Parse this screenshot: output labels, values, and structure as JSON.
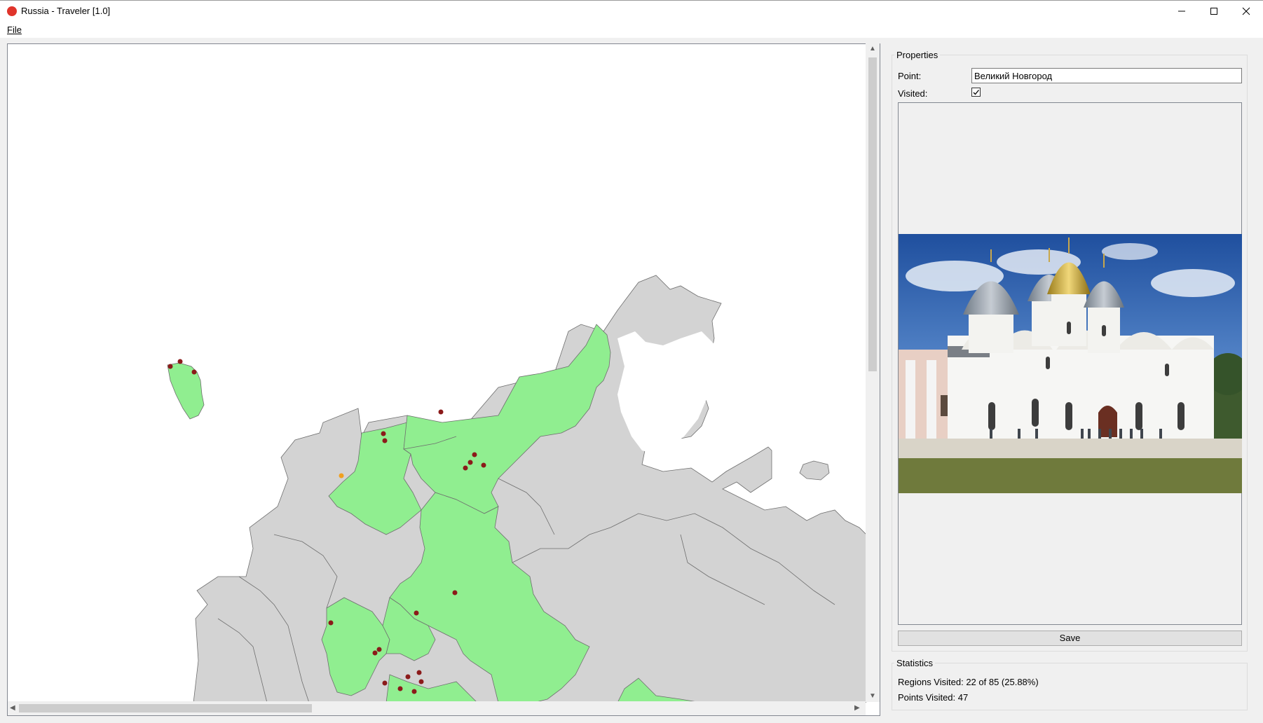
{
  "window": {
    "title": "Russia - Traveler [1.0]",
    "minimize_icon": "minimize-icon",
    "maximize_icon": "maximize-icon",
    "close_icon": "close-icon"
  },
  "menu": {
    "file_label": "File"
  },
  "map": {
    "visited_color": "#90ee90",
    "unvisited_color": "#d3d3d3",
    "point_color": "#8b1a1a",
    "selected_point_color": "#f0a020"
  },
  "properties": {
    "title": "Properties",
    "point_label": "Point:",
    "point_value": "Великий Новгород",
    "visited_label": "Visited:",
    "visited_checked": true
  },
  "save_label": "Save",
  "statistics": {
    "title": "Statistics",
    "regions_text": "Regions Visited: 22 of 85 (25.88%)",
    "points_text": "Points Visited: 47"
  }
}
